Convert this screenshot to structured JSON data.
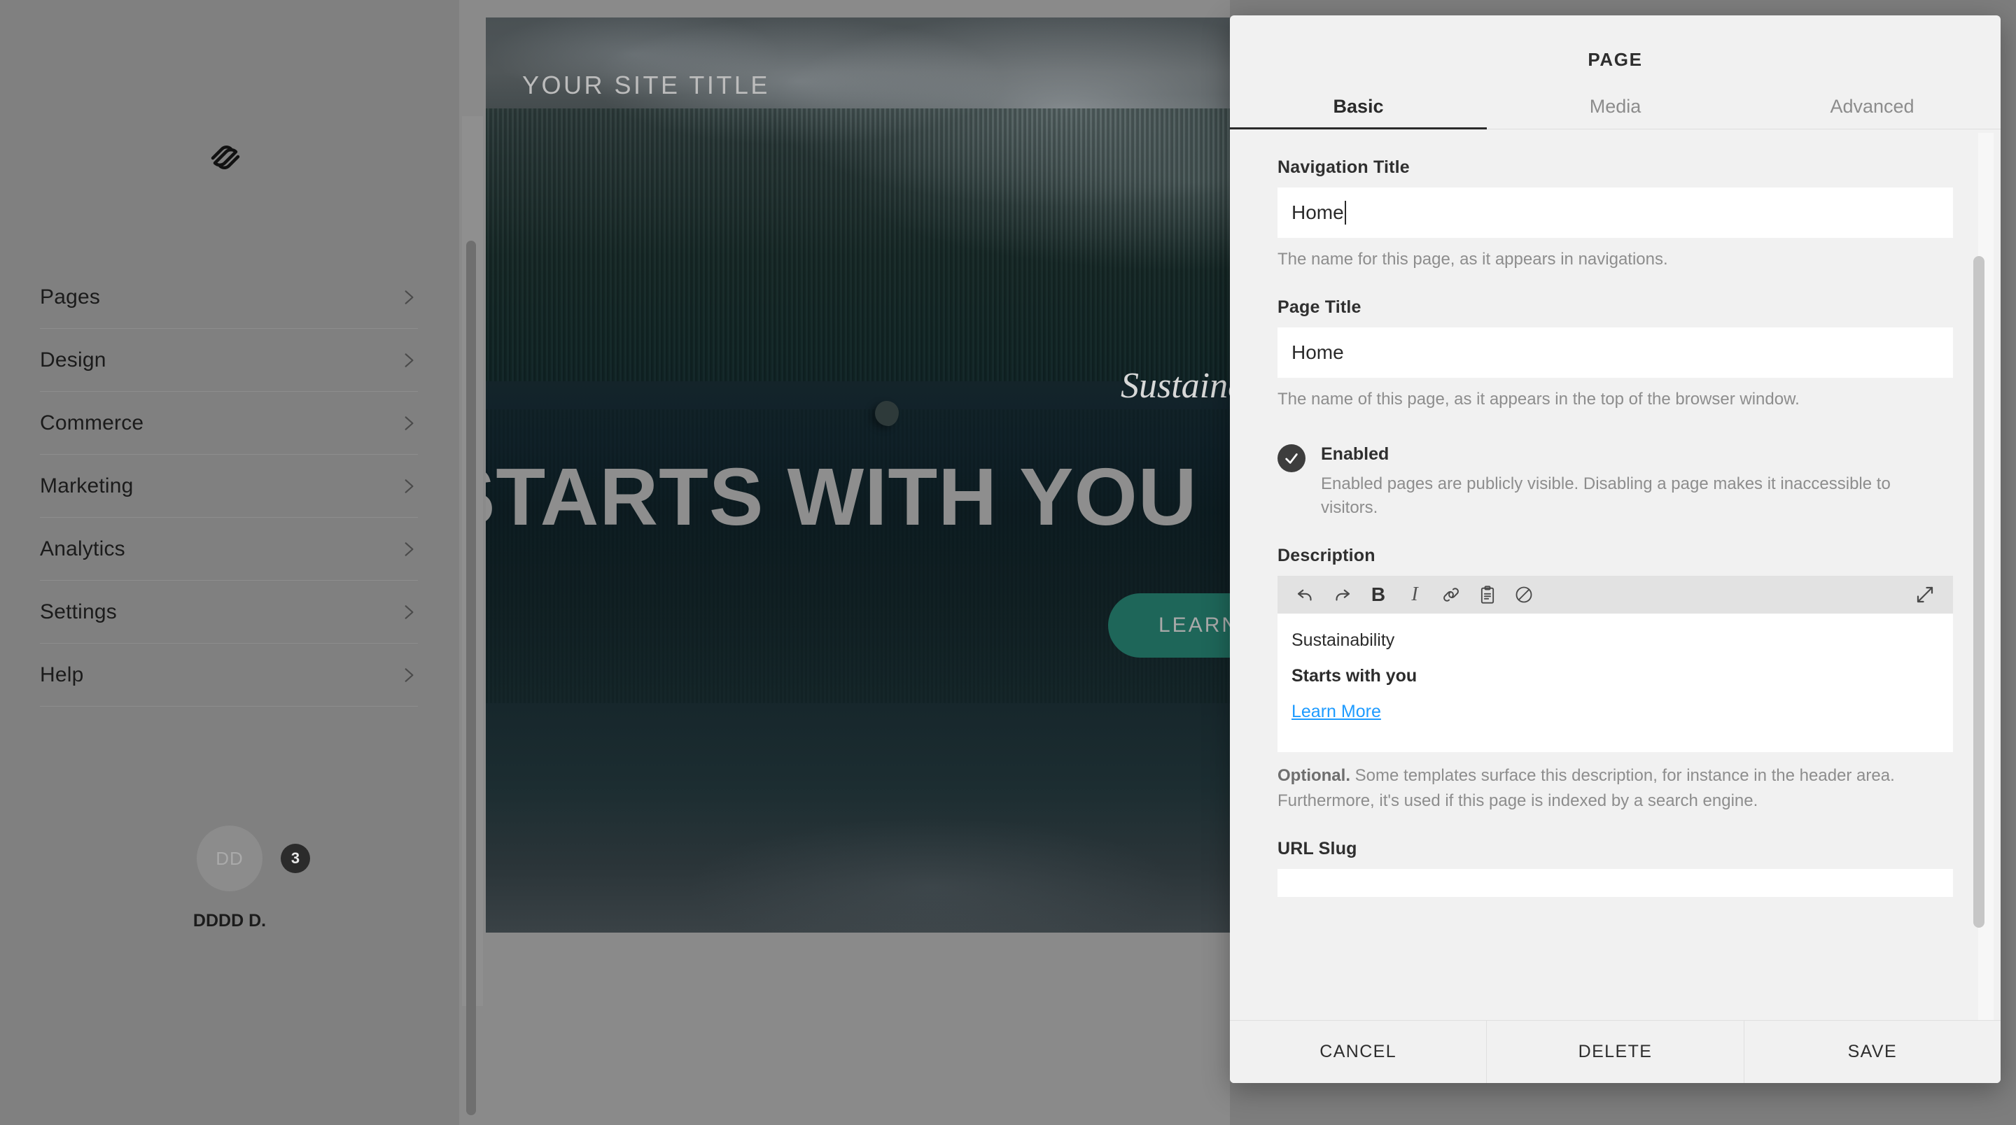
{
  "sidebar": {
    "logo_icon": "squarespace-logo",
    "items": [
      {
        "label": "Pages",
        "icon": "chevron-right-icon"
      },
      {
        "label": "Design",
        "icon": "chevron-right-icon"
      },
      {
        "label": "Commerce",
        "icon": "chevron-right-icon"
      },
      {
        "label": "Marketing",
        "icon": "chevron-right-icon"
      },
      {
        "label": "Analytics",
        "icon": "chevron-right-icon"
      },
      {
        "label": "Settings",
        "icon": "chevron-right-icon"
      },
      {
        "label": "Help",
        "icon": "chevron-right-icon"
      }
    ],
    "user": {
      "avatar_initials": "DD",
      "badge_count": "3",
      "name": "DDDD D."
    }
  },
  "preview": {
    "site_title": "YOUR SITE TITLE",
    "hero_script": "Sustainability",
    "hero_headline": "STARTS WITH YOU",
    "cta_label": "LEARN MORE",
    "cta_color": "#1e6659"
  },
  "panel": {
    "title": "PAGE",
    "tabs": [
      {
        "label": "Basic",
        "active": true
      },
      {
        "label": "Media",
        "active": false
      },
      {
        "label": "Advanced",
        "active": false
      }
    ],
    "navigation_title": {
      "label": "Navigation Title",
      "value": "Home",
      "help": "The name for this page, as it appears in navigations."
    },
    "page_title": {
      "label": "Page Title",
      "value": "Home",
      "help": "The name of this page, as it appears in the top of the browser window."
    },
    "enabled": {
      "label": "Enabled",
      "checked": true,
      "help": "Enabled pages are publicly visible. Disabling a page makes it inaccessible to visitors."
    },
    "description": {
      "label": "Description",
      "toolbar": [
        {
          "name": "undo-icon",
          "title": "Undo"
        },
        {
          "name": "redo-icon",
          "title": "Redo"
        },
        {
          "name": "bold-icon",
          "title": "B"
        },
        {
          "name": "italic-icon",
          "title": "I"
        },
        {
          "name": "link-icon",
          "title": "Link"
        },
        {
          "name": "paste-icon",
          "title": "Paste"
        },
        {
          "name": "clear-format-icon",
          "title": "Clear Formatting"
        },
        {
          "name": "expand-icon",
          "title": "Expand"
        }
      ],
      "content": {
        "line1": "Sustainability",
        "line2": "Starts with you",
        "link": "Learn More"
      },
      "note_lead": "Optional.",
      "note_rest": " Some templates surface this description, for instance in the header area. Furthermore, it's used if this page is indexed by a search engine."
    },
    "url_slug": {
      "label": "URL Slug",
      "value": ""
    },
    "footer": {
      "cancel": "CANCEL",
      "delete": "DELETE",
      "save": "SAVE"
    }
  }
}
